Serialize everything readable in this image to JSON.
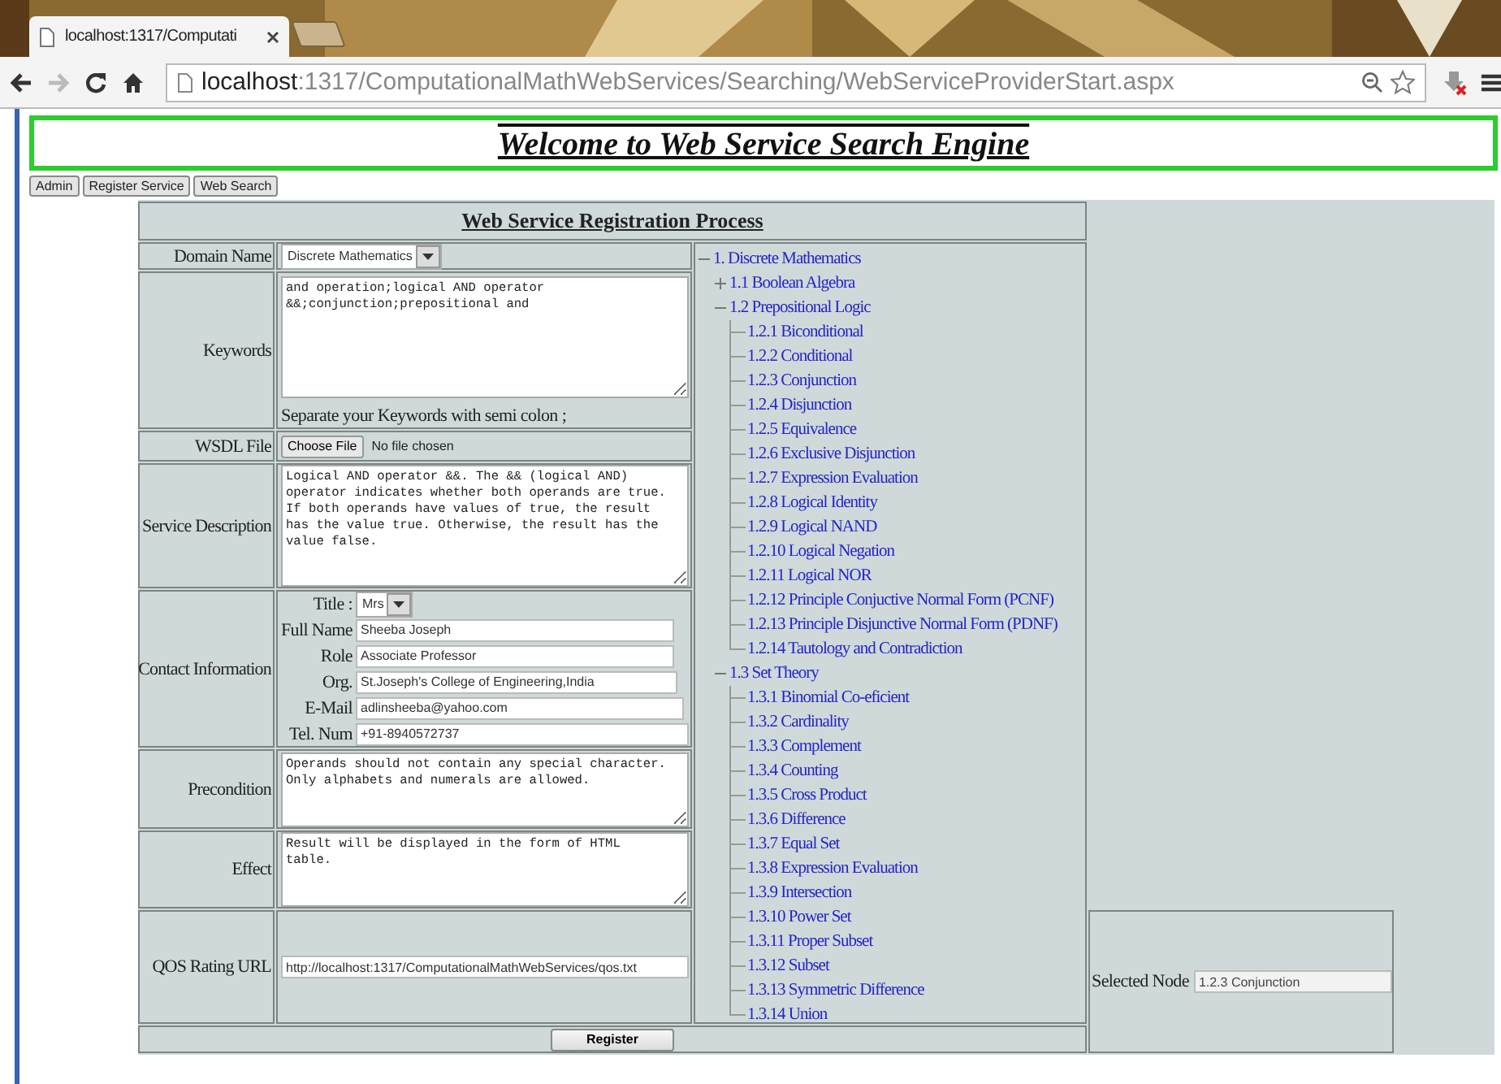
{
  "browser": {
    "tab": {
      "title": "localhost:1317/Computati"
    },
    "url": {
      "host": "localhost",
      "path": ":1317/ComputationalMathWebServices/Searching/WebServiceProviderStart.aspx"
    }
  },
  "header": {
    "title": "Welcome to Web Service Search Engine"
  },
  "nav_buttons": [
    "Admin",
    "Register Service",
    "Web Search"
  ],
  "form": {
    "title": "Web Service Registration Process",
    "domain": {
      "label": "Domain Name",
      "value": "Discrete Mathematics"
    },
    "keywords": {
      "label": "Keywords",
      "value": "and operation;logical AND operator\n&&;conjunction;prepositional and",
      "hint": "Separate your Keywords with semi colon ;"
    },
    "wsdl": {
      "label": "WSDL File",
      "button": "Choose File",
      "status": "No file chosen"
    },
    "description": {
      "label": "Service Description",
      "value": "Logical AND operator &&. The && (logical AND)\noperator indicates whether both operands are true.\nIf both operands have values of true, the result\nhas the value true. Otherwise, the result has the\nvalue false."
    },
    "contact": {
      "label": "Contact Information",
      "title": {
        "label": "Title :",
        "value": "Mrs"
      },
      "fields": [
        {
          "label": "Full Name",
          "value": "Sheeba Joseph"
        },
        {
          "label": "Role",
          "value": "Associate Professor"
        },
        {
          "label": "Org.",
          "value": "St.Joseph's College of Engineering,India"
        },
        {
          "label": "E-Mail",
          "value": "adlinsheeba@yahoo.com"
        },
        {
          "label": "Tel. Num",
          "value": "+91-8940572737"
        }
      ]
    },
    "precondition": {
      "label": "Precondition",
      "value": "Operands should not contain any special character.\nOnly alphabets and numerals are allowed."
    },
    "effect": {
      "label": "Effect",
      "value": "Result will be displayed in the form of HTML\ntable."
    },
    "qos": {
      "label": "QOS Rating URL",
      "value": "http://localhost:1317/ComputationalMathWebServices/qos.txt"
    },
    "register": "Register"
  },
  "tree": [
    {
      "label": "1. Discrete Mathematics",
      "expanded": true,
      "children": [
        {
          "label": "1.1 Boolean Algebra",
          "expanded": false
        },
        {
          "label": "1.2 Prepositional Logic",
          "expanded": true,
          "children": [
            {
              "label": "1.2.1 Biconditional"
            },
            {
              "label": "1.2.2 Conditional"
            },
            {
              "label": "1.2.3 Conjunction"
            },
            {
              "label": "1.2.4 Disjunction"
            },
            {
              "label": "1.2.5 Equivalence"
            },
            {
              "label": "1.2.6 Exclusive Disjunction"
            },
            {
              "label": "1.2.7 Expression Evaluation"
            },
            {
              "label": "1.2.8 Logical Identity"
            },
            {
              "label": "1.2.9 Logical NAND"
            },
            {
              "label": "1.2.10 Logical Negation"
            },
            {
              "label": "1.2.11 Logical NOR"
            },
            {
              "label": "1.2.12 Principle Conjuctive Normal Form (PCNF)"
            },
            {
              "label": "1.2.13 Principle Disjunctive Normal Form (PDNF)"
            },
            {
              "label": "1.2.14 Tautology and Contradiction"
            }
          ]
        },
        {
          "label": "1.3 Set Theory",
          "expanded": true,
          "children": [
            {
              "label": "1.3.1 Binomial Co-eficient"
            },
            {
              "label": "1.3.2 Cardinality"
            },
            {
              "label": "1.3.3 Complement"
            },
            {
              "label": "1.3.4 Counting"
            },
            {
              "label": "1.3.5 Cross Product"
            },
            {
              "label": "1.3.6 Difference"
            },
            {
              "label": "1.3.7 Equal Set"
            },
            {
              "label": "1.3.8 Expression Evaluation"
            },
            {
              "label": "1.3.9 Intersection"
            },
            {
              "label": "1.3.10 Power Set"
            },
            {
              "label": "1.3.11 Proper Subset"
            },
            {
              "label": "1.3.12 Subset"
            },
            {
              "label": "1.3.13 Symmetric Difference"
            },
            {
              "label": "1.3.14 Union"
            }
          ]
        }
      ]
    }
  ],
  "selected_node": {
    "label": "Selected Node",
    "value": "1.2.3 Conjunction"
  }
}
